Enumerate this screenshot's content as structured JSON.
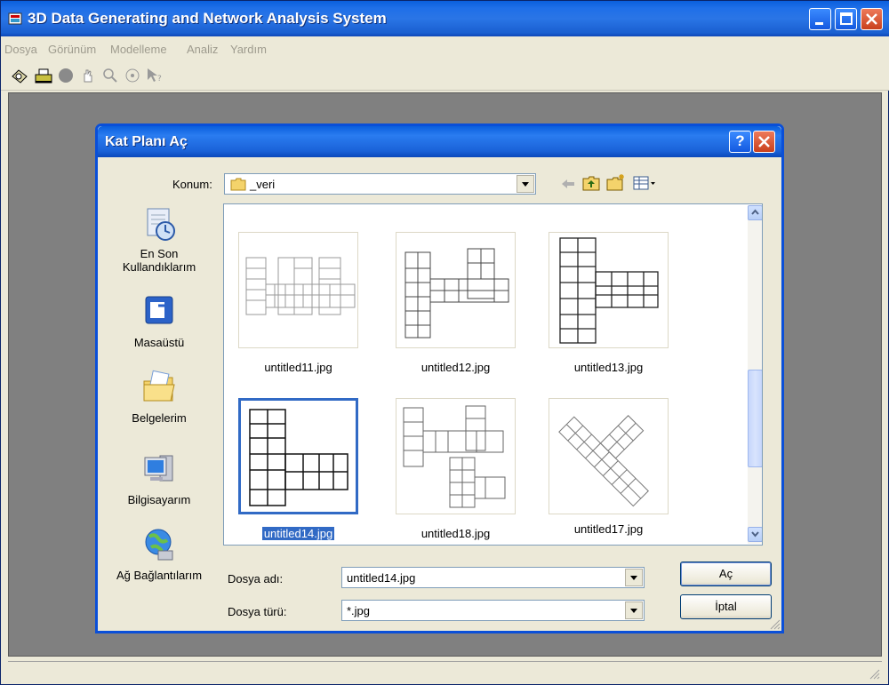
{
  "app": {
    "title": "3D Data Generating and Network Analysis System",
    "menu": [
      "Dosya",
      "Görünüm",
      "Modelleme",
      "Analiz",
      "Yardım"
    ],
    "toolbar_icons": [
      "network-tool-icon",
      "print-icon",
      "circle-tool-icon",
      "hand-pan-icon",
      "zoom-icon",
      "target-icon",
      "pointer-help-icon"
    ]
  },
  "dialog": {
    "title": "Kat Planı Aç",
    "location_label": "Konum:",
    "location_value": "_veri",
    "places": [
      {
        "label_line1": "En Son",
        "label_line2": "Kullandıklarım",
        "icon": "recent-icon"
      },
      {
        "label_line1": "Masaüstü",
        "label_line2": "",
        "icon": "desktop-icon"
      },
      {
        "label_line1": "Belgelerim",
        "label_line2": "",
        "icon": "my-documents-icon"
      },
      {
        "label_line1": "Bilgisayarım",
        "label_line2": "",
        "icon": "my-computer-icon"
      },
      {
        "label_line1": "Ağ Bağlantılarım",
        "label_line2": "",
        "icon": "network-places-icon"
      }
    ],
    "files": [
      {
        "name": "untitled11.jpg"
      },
      {
        "name": "untitled12.jpg"
      },
      {
        "name": "untitled13.jpg"
      },
      {
        "name": "untitled14.jpg",
        "selected": true
      },
      {
        "name": "untitled18.jpg"
      },
      {
        "name": "untitled17.jpg"
      }
    ],
    "filename_label": "Dosya adı:",
    "filename_value": "untitled14.jpg",
    "filetype_label": "Dosya türü:",
    "filetype_value": "*.jpg",
    "open_button": "Aç",
    "cancel_button": "İptal"
  },
  "colors": {
    "titlebar": "#1f6fe8",
    "selection": "#316ac5",
    "workspace": "#808080"
  }
}
